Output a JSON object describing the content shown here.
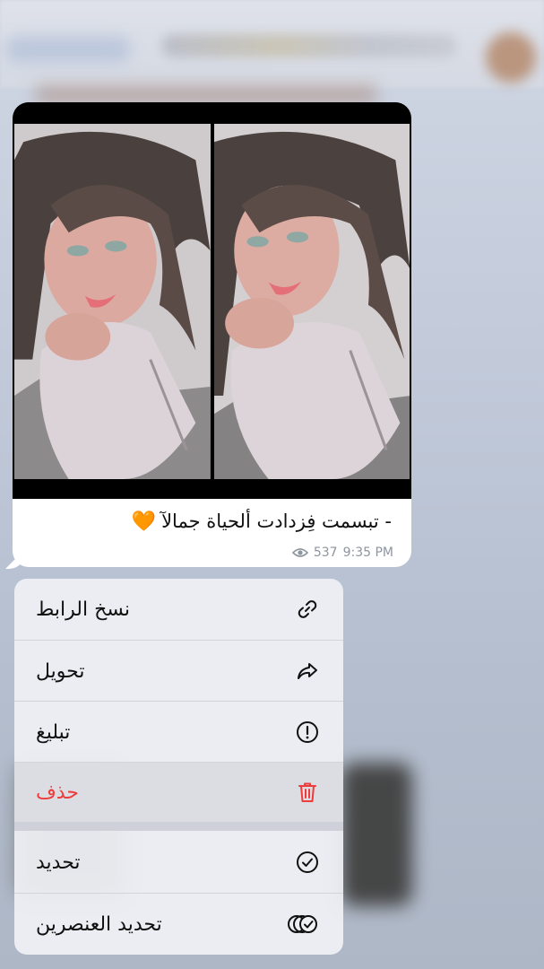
{
  "message": {
    "caption": "- تبسمت فِزدادت ألحياة جمالآ",
    "caption_emoji": "🧡",
    "views": "537",
    "time": "9:35 PM"
  },
  "menu": {
    "items": [
      {
        "label": "نسخ الرابط",
        "icon": "link-icon"
      },
      {
        "label": "تحويل",
        "icon": "forward-icon"
      },
      {
        "label": "تبليغ",
        "icon": "report-icon"
      },
      {
        "label": "حذف",
        "icon": "trash-icon"
      },
      {
        "label": "تحديد",
        "icon": "checkmark-circle-icon"
      },
      {
        "label": "تحديد العنصرين",
        "icon": "select-multiple-icon"
      }
    ]
  },
  "colors": {
    "destructive": "#ef3b3a",
    "caption_emoji": "#f28a1b",
    "meta_text": "#8e959f"
  }
}
